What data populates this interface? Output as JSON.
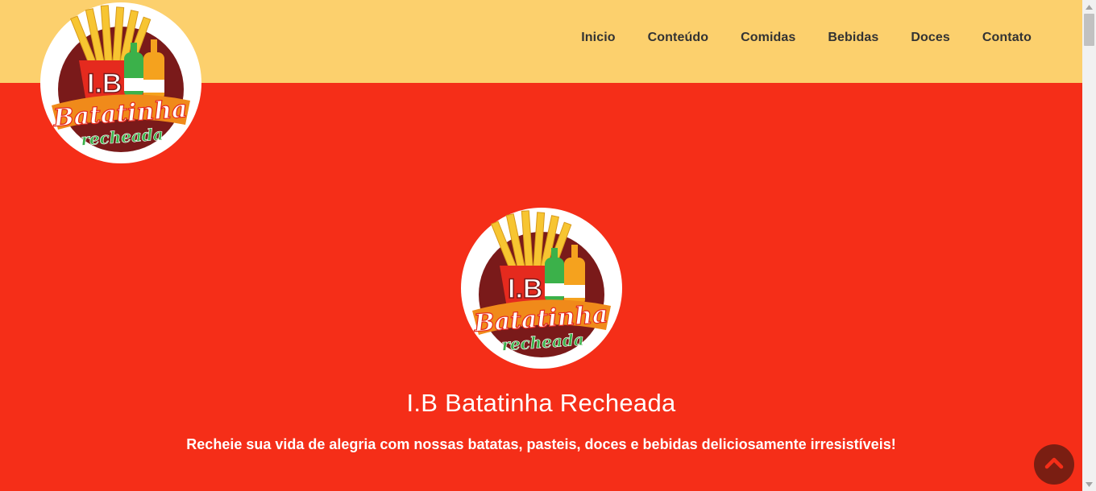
{
  "brand": {
    "logo_text_main": "I.B",
    "logo_text_script": "Batatinha",
    "logo_text_sub": "recheada"
  },
  "nav": {
    "items": [
      {
        "label": "Inicio"
      },
      {
        "label": "Conteúdo"
      },
      {
        "label": "Comidas"
      },
      {
        "label": "Bebidas"
      },
      {
        "label": "Doces"
      },
      {
        "label": "Contato"
      }
    ]
  },
  "hero": {
    "title": "I.B Batatinha Recheada",
    "subtitle": "Recheie sua vida de alegria com nossas batatas, pasteis, doces e bebidas deliciosamente irresistíveis!"
  },
  "colors": {
    "header_bg": "#fcd06d",
    "page_bg": "#f52e18",
    "back_to_top_bg": "#7a1e12"
  },
  "icons": {
    "back_to_top": "chevron-up-icon"
  }
}
